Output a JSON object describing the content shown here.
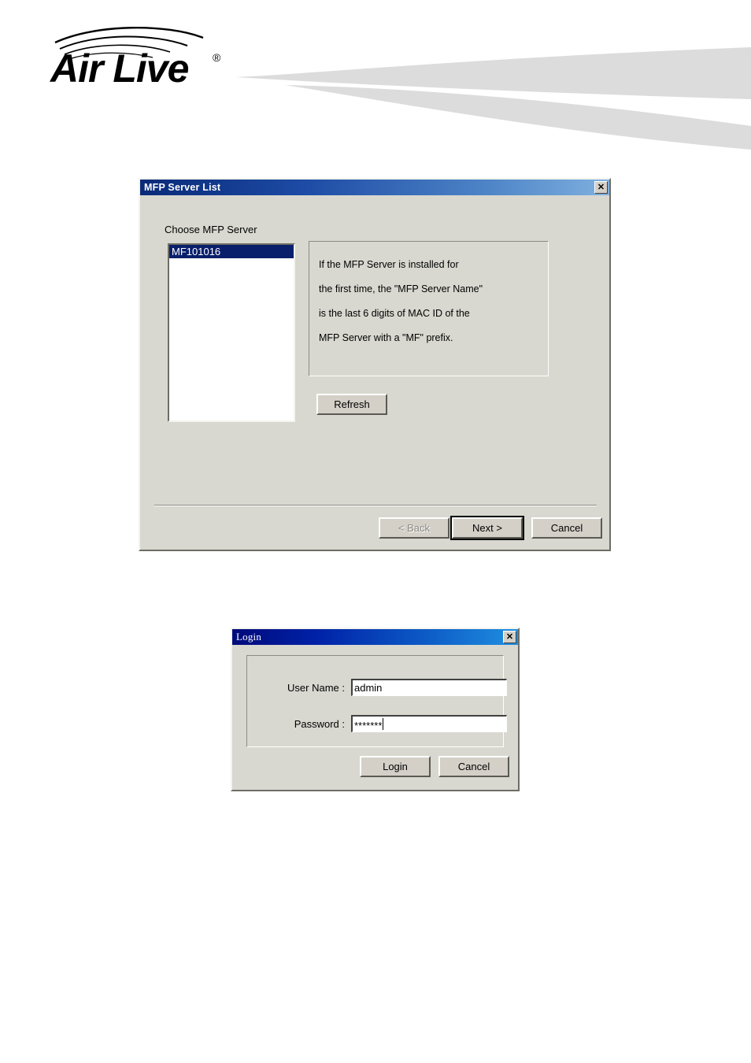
{
  "header": {
    "brand_name": "Air Live",
    "brand_trademark": "®",
    "swoosh_color": "#dcdcdc"
  },
  "mfp_dialog": {
    "title": "MFP Server List",
    "close_icon": "close-icon",
    "choose_label": "Choose MFP Server",
    "server_list": [
      {
        "name": "MF101016",
        "selected": true
      }
    ],
    "info_lines": [
      "If the MFP Server is installed for",
      "the first time, the \"MFP Server Name\"",
      "is the last 6 digits of MAC ID of the",
      "MFP Server with a \"MF\" prefix."
    ],
    "refresh_label": "Refresh",
    "back_label": "< Back",
    "back_disabled": true,
    "next_label": "Next >",
    "next_is_default": true,
    "cancel_label": "Cancel",
    "titlebar_gradient_start": "#0a2a78",
    "titlebar_gradient_end": "#7fb0df",
    "selection_color": "#0a1f6b",
    "face_color": "#d8d8d0"
  },
  "login_dialog": {
    "title": "Login",
    "close_icon": "close-icon",
    "username_label": "User Name :",
    "username_value": "admin",
    "password_label": "Password :",
    "password_value": "*******",
    "login_label": "Login",
    "cancel_label": "Cancel",
    "titlebar_gradient_start": "#000a7a",
    "titlebar_gradient_end": "#1f8fe0"
  }
}
